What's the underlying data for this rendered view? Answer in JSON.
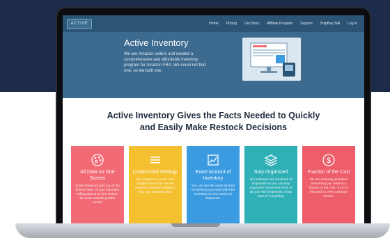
{
  "colors": {
    "page_bg_top": "#1c2b49",
    "nav_bg": "#2c5474",
    "hero_bg": "#3d6a8f",
    "card_red": "#f26a75",
    "card_yellow": "#f4c02f",
    "card_blue": "#3a9be0",
    "card_teal": "#2fb0b6",
    "card_pink": "#ee5d6a"
  },
  "site": {
    "logo_text": "ACTIVE",
    "nav": [
      "Home",
      "Pricing",
      "Our Story",
      "Affiliate Program",
      "Support",
      "ShipBay Sell",
      "Log In"
    ]
  },
  "hero": {
    "title": "Active Inventory",
    "text": "We are Amazon sellers and wanted a comprehensive and affordable inventory program for Amazon FBA. We could not find one, so we built one."
  },
  "headline": {
    "line1": "Active Inventory Gives the Facts Needed to Quickly",
    "line2": "and Easily Make Restock Decisions"
  },
  "cards": [
    {
      "icon": "palette-icon",
      "title": "All Data on One Screen",
      "text": "Active Inventory puts you in the driver's seat. All your important selling data is on one screen. No more searching seller central."
    },
    {
      "icon": "menu-lines-icon",
      "title": "Customized Settings",
      "text": "The program is yours. Use multiple users that see the inventory result according to your own business plan."
    },
    {
      "icon": "chart-icon",
      "title": "Exact Amount of Inventory",
      "text": "You can see the exact amount of inventory you need with FBA inventory on one screen in shipments."
    },
    {
      "icon": "layers-icon",
      "title": "Stay Organized",
      "text": "Our software has hundreds of shipments so you can stay organized. Never lose track of all your FBA shipments. Keep track of everything."
    },
    {
      "icon": "dollar-icon",
      "title": "Fraction of the Cost",
      "text": "We are inventory providers everything you need at a fraction of the cost. Try it for free and no 75% customer service."
    }
  ]
}
